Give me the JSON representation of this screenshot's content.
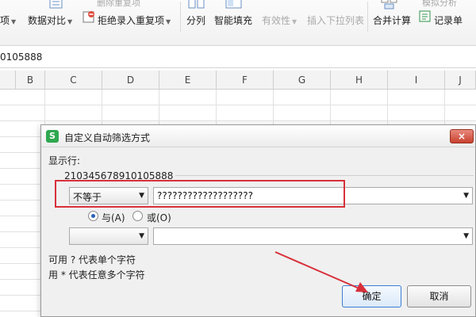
{
  "ribbon": {
    "item_partial": "项",
    "data_compare": "数据对比",
    "reject_duplicates": "拒绝录入重复项",
    "top_partial": "删除重复项",
    "split_columns": "分列",
    "smart_fill": "智能填充",
    "validity": "有效性",
    "insert_dropdown": "插入下拉列表",
    "consolidate": "合并计算",
    "record_sheet": "记录单",
    "top_right_partial": "模拟分析"
  },
  "formula_bar": {
    "value": "0105888"
  },
  "columns": [
    "B",
    "C",
    "D",
    "E",
    "F",
    "G",
    "H",
    "I",
    "J"
  ],
  "dialog": {
    "title": "自定义自动筛选方式",
    "close_label": "×",
    "show_rows_label": "显示行:",
    "field_name": "210345678910105888",
    "condition1": {
      "operator": "不等于",
      "value": "???????????????????"
    },
    "condition2": {
      "operator": "",
      "value": ""
    },
    "and_label": "与(A)",
    "or_label": "或(O)",
    "logic_selected": "and",
    "hint1": "可用 ? 代表单个字符",
    "hint2": "用 * 代表任意多个字符",
    "ok_label": "确定",
    "cancel_label": "取消"
  },
  "icons": {
    "app": "spreadsheet-app-icon",
    "close": "close-icon",
    "dropdown": "chevron-down-icon",
    "annotation": "red-arrow-annotation"
  },
  "colors": {
    "annotation_red": "#d8303a",
    "primary_button_border": "#3c7fd3",
    "close_button": "#c8412e",
    "app_icon": "#2fa84f"
  }
}
